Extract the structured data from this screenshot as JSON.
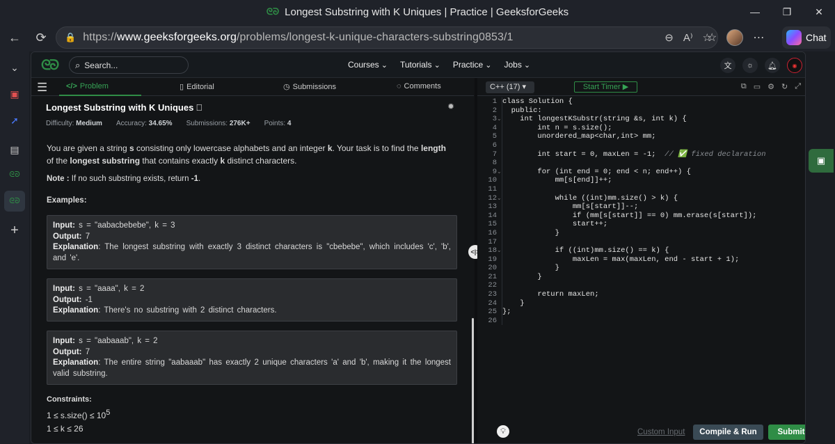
{
  "window": {
    "title": "Longest Substring with K Uniques | Practice | GeeksforGeeks",
    "minimize": "—",
    "restore": "❐",
    "close": "✕"
  },
  "browser": {
    "url_prefix": "https://",
    "url_host": "www.geeksforgeeks.org",
    "url_path": "/problems/longest-k-unique-characters-substring0853/1",
    "chat_label": "Chat"
  },
  "gfg_nav": {
    "logo": "ᘓᘐ",
    "search_placeholder": "Search...",
    "menu": [
      "Courses",
      "Tutorials",
      "Practice",
      "Jobs"
    ]
  },
  "tabs": {
    "problem": "Problem",
    "editorial": "Editorial",
    "submissions": "Submissions",
    "comments": "Comments"
  },
  "problem": {
    "title": "Longest Substring with K Uniques",
    "difficulty_label": "Difficulty:",
    "difficulty": "Medium",
    "accuracy_label": "Accuracy:",
    "accuracy": "34.65%",
    "submissions_label": "Submissions:",
    "submissions": "276K+",
    "points_label": "Points:",
    "points": "4",
    "desc_1": "You are given a string ",
    "desc_s": "s",
    "desc_2": " consisting only lowercase alphabets and an integer ",
    "desc_k": "k",
    "desc_3": ". Your task is to find the ",
    "desc_length": "length",
    "desc_4": " of the ",
    "desc_ls": "longest substring",
    "desc_5": " that contains exactly ",
    "desc_k2": "k",
    "desc_6": " distinct characters.",
    "note_label": "Note :",
    "note_1": " If no such substring exists, return ",
    "note_val": "-1",
    "note_2": ".",
    "examples_label": "Examples:",
    "examples": [
      {
        "input": " s = \"aabacbebebe\", k = 3",
        "output": " 7",
        "explanation": " The longest substring with exactly 3 distinct characters is \"cbebebe\", which includes 'c', 'b', and 'e'."
      },
      {
        "input": " s = \"aaaa\", k = 2",
        "output": " -1",
        "explanation": " There's no substring with 2 distinct characters."
      },
      {
        "input": " s = \"aabaaab\", k = 2",
        "output": " 7",
        "explanation": " The entire string \"aabaaab\" has exactly 2 unique characters 'a' and 'b', making it the longest valid substring."
      }
    ],
    "input_label": "Input:",
    "output_label": "Output:",
    "explanation_label": "Explanation",
    "constraints_label": "Constraints:",
    "constraint_1": "1 ≤ s.size() ≤ 10",
    "constraint_1_exp": "5",
    "constraint_2": "1 ≤ k ≤ 26"
  },
  "editor": {
    "language": "C++ (17)",
    "timer": "Start Timer",
    "lines": [
      "class Solution {",
      "  public:",
      "    int longestKSubstr(string &s, int k) {",
      "        int n = s.size();",
      "        unordered_map<char,int> mm;",
      "",
      "        int start = 0, maxLen = -1;  // ✅ fixed declaration",
      "",
      "        for (int end = 0; end < n; end++) {",
      "            mm[s[end]]++;",
      "",
      "            while ((int)mm.size() > k) {",
      "                mm[s[start]]--;",
      "                if (mm[s[start]] == 0) mm.erase(s[start]);",
      "                start++;",
      "            }",
      "",
      "            if ((int)mm.size() == k) {",
      "                maxLen = max(maxLen, end - start + 1);",
      "            }",
      "        }",
      "",
      "        return maxLen;",
      "    }",
      "};",
      ""
    ],
    "custom_input": "Custom Input",
    "compile_run": "Compile & Run",
    "submit": "Submit"
  }
}
